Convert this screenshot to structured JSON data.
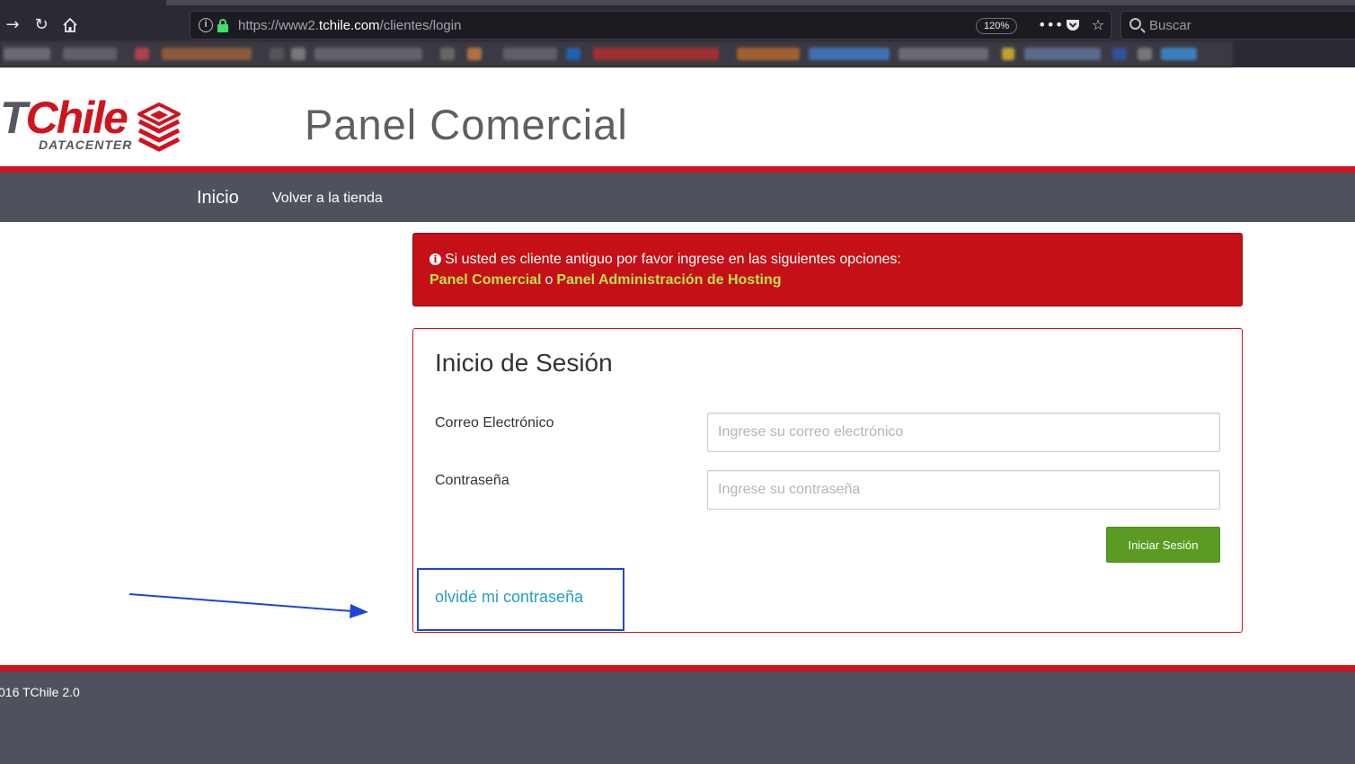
{
  "browser": {
    "url_scheme": "https://www2.",
    "url_host": "tchile.com",
    "url_path": "/clientes/login",
    "zoom": "120%",
    "search_placeholder": "Buscar",
    "icons": {
      "forward": "arrow-right-icon",
      "reload": "reload-icon",
      "home": "home-icon",
      "page_actions": "more-icon",
      "pocket": "pocket-icon",
      "bookmark": "star-icon"
    }
  },
  "header": {
    "logo_t": "T",
    "logo_rest": "Chile",
    "logo_sub": "DATACENTER",
    "title": "Panel Comercial",
    "brand_red": "#d0141f"
  },
  "nav": {
    "home": "Inicio",
    "store": "Volver a la tienda",
    "background": "#4d525c"
  },
  "alert": {
    "message": "Si usted es cliente antiguo por favor ingrese en las siguientes opciones:",
    "link_commercial": "Panel Comercial",
    "separator": "o",
    "link_hosting": "Panel Administración de Hosting",
    "background": "#c51018",
    "link_color": "#b8e04a"
  },
  "login": {
    "title": "Inicio de Sesión",
    "email_label": "Correo Electrónico",
    "email_placeholder": "Ingrese su correo electrónico",
    "email_value": "",
    "password_label": "Contraseña",
    "password_placeholder": "Ingrese su contraseña",
    "password_value": "",
    "submit": "Iniciar Sesión",
    "forgot": "olvidé mi contraseña",
    "submit_color": "#5b9b24",
    "forgot_color": "#22a0c4",
    "highlight_color": "#1e45d8"
  },
  "footer": {
    "text": "016 TChile 2.0"
  }
}
